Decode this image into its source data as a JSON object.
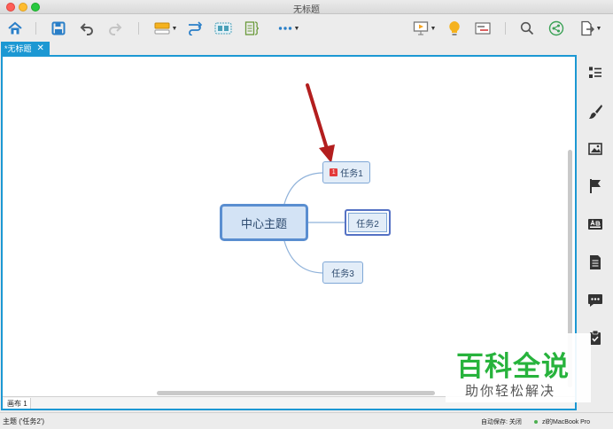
{
  "window": {
    "title": "无标题"
  },
  "tab": {
    "label": "*无标题",
    "close": "✕"
  },
  "map": {
    "central": "中心主题",
    "subtopics": [
      {
        "label": "任务1",
        "badge": "1"
      },
      {
        "label": "任务2"
      },
      {
        "label": "任务3"
      }
    ]
  },
  "sheet": {
    "label": "画布 1"
  },
  "status": {
    "selection": "主题 ('任务2')",
    "autosave": "自动保存: 关闭",
    "user": "zl的MacBook Pro"
  },
  "watermark": {
    "title": "百科全说",
    "subtitle": "助你轻松解决"
  },
  "colors": {
    "accent": "#1c98d3",
    "branch": "#8fb2da",
    "arrow": "#b31e1e",
    "badge": "#e33b3b"
  },
  "icons": {
    "toolbar": [
      "home-icon",
      "save-icon",
      "undo-icon",
      "redo-icon",
      "insert-topic-icon",
      "relationship-icon",
      "boundary-icon",
      "summary-icon",
      "more-icon",
      "presentation-icon",
      "brainstorm-icon",
      "gantt-icon",
      "search-icon",
      "share-icon",
      "export-icon"
    ],
    "sidebar": [
      "outline-icon",
      "format-brush-icon",
      "image-icon",
      "flag-icon",
      "text-style-icon",
      "notes-icon",
      "comment-icon",
      "task-icon"
    ]
  }
}
